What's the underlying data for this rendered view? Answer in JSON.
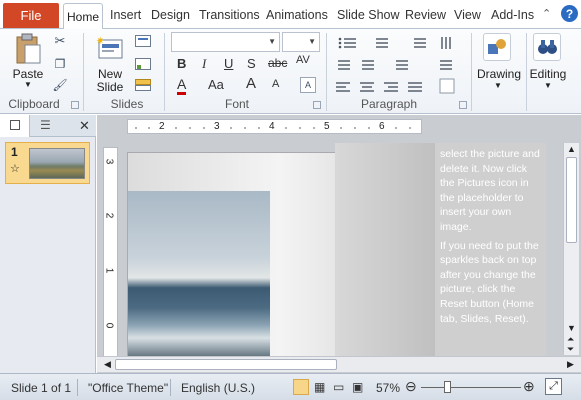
{
  "tabs": {
    "file": "File",
    "home": "Home",
    "insert": "Insert",
    "design": "Design",
    "transitions": "Transitions",
    "animations": "Animations",
    "slideshow": "Slide Show",
    "review": "Review",
    "view": "View",
    "addins": "Add-Ins"
  },
  "ribbon": {
    "clipboard": {
      "label": "Clipboard",
      "paste": "Paste"
    },
    "slides": {
      "label": "Slides",
      "new_slide_1": "New",
      "new_slide_2": "Slide"
    },
    "font": {
      "label": "Font",
      "bold": "B",
      "italic": "I",
      "underline": "U",
      "shadow": "S",
      "strike": "abc",
      "spacing": "AV",
      "font_color": "A",
      "change_case": "Aa",
      "grow": "A",
      "shrink": "A"
    },
    "paragraph": {
      "label": "Paragraph"
    },
    "drawing": {
      "label": "Drawing"
    },
    "editing": {
      "label": "Editing"
    }
  },
  "help_glyph": "?",
  "left_pane": {
    "slide_number": "1",
    "star": "☆"
  },
  "ruler": {
    "h_marks": [
      "2",
      "3",
      "4",
      "5",
      "6"
    ],
    "v_marks": [
      "3",
      "2",
      "1",
      "0"
    ]
  },
  "textbox": {
    "para1": "select the picture and delete it. Now click the Pictures icon in the placeholder to insert your own image.",
    "para2": "If you need to put the sparkles back on top after you change the picture, click the Reset button (Home tab, Slides, Reset)."
  },
  "status": {
    "slide": "Slide 1 of 1",
    "theme": "\"Office Theme\"",
    "language": "English (U.S.)",
    "zoom": "57%",
    "zoom_level": 0.57
  }
}
